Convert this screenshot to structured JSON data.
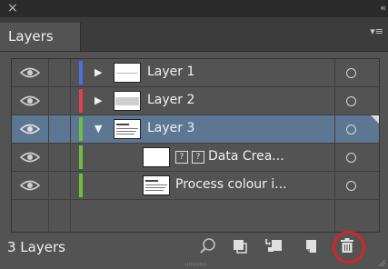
{
  "window": {
    "close_glyph": "×",
    "collapse_glyph": "‹‹"
  },
  "panel": {
    "tab_label": "Layers",
    "menu_glyph": "▾≡"
  },
  "layers": [
    {
      "name": "Layer 1",
      "color": "#4b6fdc",
      "twisty": "▶",
      "thumbnail": "thumb-layer-1"
    },
    {
      "name": "Layer 2",
      "color": "#e0414d",
      "twisty": "▶",
      "thumbnail": "thumb-layer-2"
    },
    {
      "name": "Layer 3",
      "color": "#6fbe44",
      "twisty": "▼",
      "thumbnail": "thumb-layer-3",
      "selected": true
    },
    {
      "name": "Data Crea...",
      "prefix_glyph": "?",
      "color": "#6fbe44",
      "thumbnail": "thumb-blank"
    },
    {
      "name": "Process colour i...",
      "color": "#6fbe44",
      "thumbnail": "thumb-document"
    }
  ],
  "footer": {
    "count_label": "3 Layers",
    "icons": [
      "locate-object-icon",
      "make-clipping-mask-icon",
      "create-sublayer-icon",
      "create-new-layer-icon",
      "delete-selection-icon"
    ],
    "highlight_color": "#d6252a"
  }
}
